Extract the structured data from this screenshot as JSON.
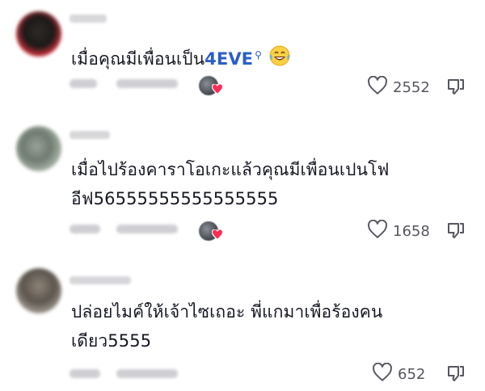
{
  "comments": [
    {
      "text_parts": [
        "เมื่อคุณมีเพื่อนเป็น"
      ],
      "mention": "4EVE",
      "emoji": "laughing-tears-icon",
      "text": "",
      "likes": "2552",
      "creator_liked": true
    },
    {
      "text": "เมื่อไปร้องคาราโอเกะแล้วคุณมีเพื่อนเปนโฟ",
      "text_line2": "อีฟ56555555555555555",
      "likes": "1658",
      "creator_liked": true
    },
    {
      "text": "ปล่อยไมค์ให้เจ้าไซเถอะ พี่แกมาเพื่อร้องคน",
      "text_line2": "เดียว5555",
      "likes": "652",
      "creator_liked": false
    }
  ],
  "colors": {
    "mention": "#2b5ec8",
    "heart_red": "#fe2c55",
    "count_gray": "#55565e"
  }
}
